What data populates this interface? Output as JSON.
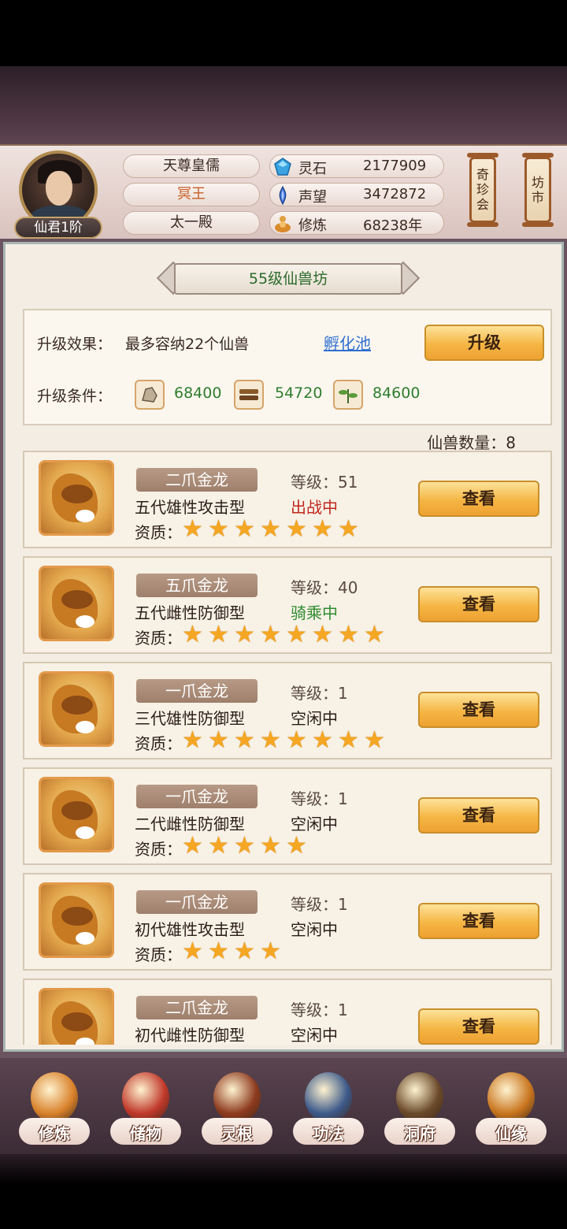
{
  "header": {
    "rank_badge": "仙君1阶",
    "name_rows": [
      "天尊皇儒",
      "冥王",
      "太一殿"
    ],
    "resources": [
      {
        "icon": "spirit-stone-icon",
        "label": "灵石",
        "value": "2177909"
      },
      {
        "icon": "prestige-icon",
        "label": "声望",
        "value": "3472872"
      },
      {
        "icon": "cultivation-icon",
        "label": "修炼",
        "value": "68238年"
      }
    ],
    "side_buttons": [
      {
        "label": "奇\n珍\n会"
      },
      {
        "label": "坊\n市"
      }
    ]
  },
  "panel": {
    "title": "55级仙兽坊",
    "upgrade_effect_label": "升级效果：",
    "upgrade_effect_value": "最多容纳22个仙兽",
    "hatch_link": "孵化池",
    "upgrade_button": "升级",
    "upgrade_condition_label": "升级条件：",
    "materials": [
      {
        "icon": "ore-material-icon",
        "value": "68400"
      },
      {
        "icon": "wood-material-icon",
        "value": "54720"
      },
      {
        "icon": "herb-material-icon",
        "value": "84600"
      }
    ],
    "beast_count_label": "仙兽数量：8"
  },
  "beasts": [
    {
      "name": "二爪金龙",
      "type": "五代雄性攻击型",
      "level": "等级：51",
      "status": "出战中",
      "status_color": "#c0281e",
      "stars": 7,
      "aptitude_label": "资质：",
      "view_button": "查看"
    },
    {
      "name": "五爪金龙",
      "type": "五代雌性防御型",
      "level": "等级：40",
      "status": "骑乘中",
      "status_color": "#2e8b2e",
      "stars": 8,
      "aptitude_label": "资质：",
      "view_button": "查看"
    },
    {
      "name": "一爪金龙",
      "type": "三代雄性防御型",
      "level": "等级：1",
      "status": "空闲中",
      "status_color": "#2b1e18",
      "stars": 8,
      "aptitude_label": "资质：",
      "view_button": "查看"
    },
    {
      "name": "一爪金龙",
      "type": "二代雌性防御型",
      "level": "等级：1",
      "status": "空闲中",
      "status_color": "#2b1e18",
      "stars": 5,
      "aptitude_label": "资质：",
      "view_button": "查看"
    },
    {
      "name": "一爪金龙",
      "type": "初代雄性攻击型",
      "level": "等级：1",
      "status": "空闲中",
      "status_color": "#2b1e18",
      "stars": 4,
      "aptitude_label": "资质：",
      "view_button": "查看"
    },
    {
      "name": "二爪金龙",
      "type": "初代雌性防御型",
      "level": "等级：1",
      "status": "空闲中",
      "status_color": "#2b1e18",
      "stars": 0,
      "aptitude_label": "",
      "view_button": "查看"
    }
  ],
  "bottom_nav": [
    {
      "icon": "cultivate-monk-icon",
      "label": "修炼",
      "color": "#d9822b"
    },
    {
      "icon": "storage-bag-icon",
      "label": "储物",
      "color": "#c0392b"
    },
    {
      "icon": "spirit-root-icon",
      "label": "灵根",
      "color": "#8e3b1f"
    },
    {
      "icon": "technique-book-icon",
      "label": "功法",
      "color": "#3d5a8a"
    },
    {
      "icon": "cave-palace-icon",
      "label": "洞府",
      "color": "#6b4a2a"
    },
    {
      "icon": "fate-gourd-icon",
      "label": "仙缘",
      "color": "#c9761f"
    }
  ],
  "colors": {
    "accent_green": "#2e7d2e",
    "link_blue": "#2e6fd0",
    "star": "#f5a623"
  }
}
